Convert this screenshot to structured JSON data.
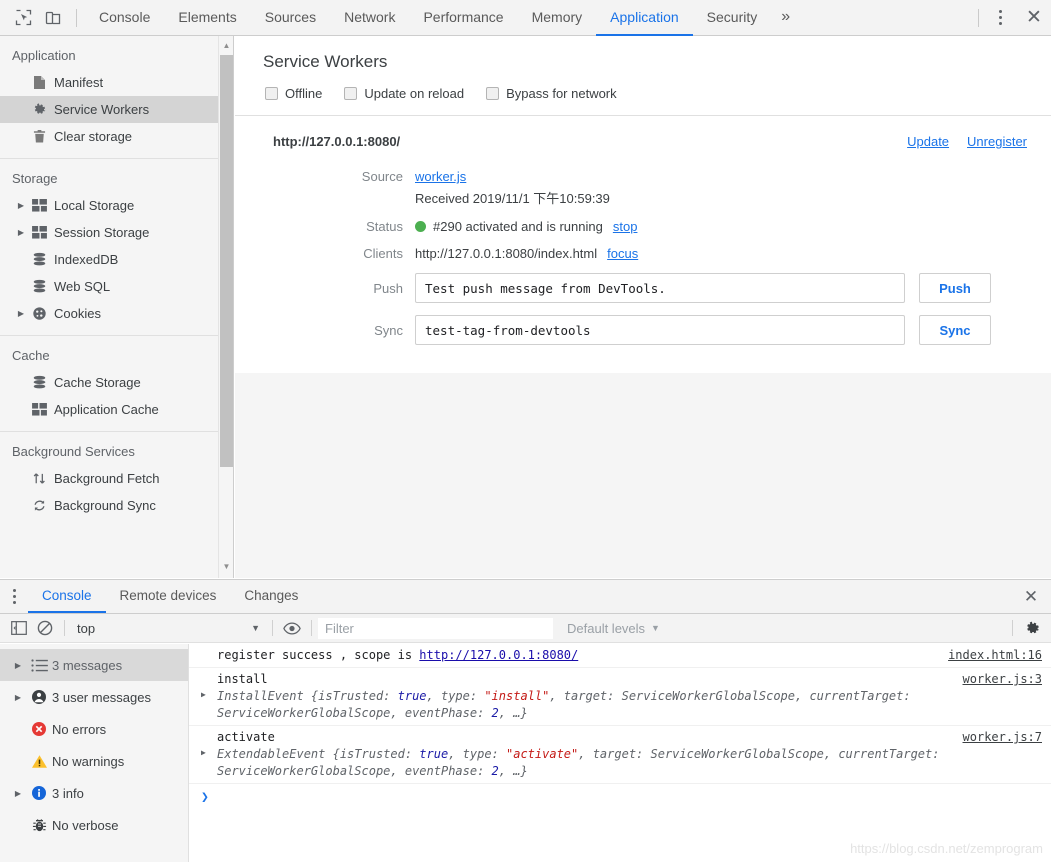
{
  "toolbar": {
    "inspect_icon": "inspect-cursor-icon",
    "device_icon": "device-toolbar-icon",
    "tabs": [
      {
        "label": "Console",
        "selected": false
      },
      {
        "label": "Elements",
        "selected": false
      },
      {
        "label": "Sources",
        "selected": false
      },
      {
        "label": "Network",
        "selected": false
      },
      {
        "label": "Performance",
        "selected": false
      },
      {
        "label": "Memory",
        "selected": false
      },
      {
        "label": "Application",
        "selected": true
      },
      {
        "label": "Security",
        "selected": false
      }
    ],
    "more_tabs_label": "»",
    "menu_label": "⋮",
    "close_label": "✕"
  },
  "sidebar": {
    "groups": [
      {
        "title": "Application",
        "items": [
          {
            "label": "Manifest",
            "icon": "document-icon",
            "arrow": false,
            "selected": false
          },
          {
            "label": "Service Workers",
            "icon": "gear-icon",
            "arrow": false,
            "selected": true
          },
          {
            "label": "Clear storage",
            "icon": "trash-icon",
            "arrow": false,
            "selected": false
          }
        ]
      },
      {
        "title": "Storage",
        "items": [
          {
            "label": "Local Storage",
            "icon": "table-icon",
            "arrow": true,
            "selected": false
          },
          {
            "label": "Session Storage",
            "icon": "table-icon",
            "arrow": true,
            "selected": false
          },
          {
            "label": "IndexedDB",
            "icon": "database-icon",
            "arrow": false,
            "selected": false
          },
          {
            "label": "Web SQL",
            "icon": "database-icon",
            "arrow": false,
            "selected": false
          },
          {
            "label": "Cookies",
            "icon": "cookie-icon",
            "arrow": true,
            "selected": false
          }
        ]
      },
      {
        "title": "Cache",
        "items": [
          {
            "label": "Cache Storage",
            "icon": "database-icon",
            "arrow": false,
            "selected": false
          },
          {
            "label": "Application Cache",
            "icon": "table-icon",
            "arrow": false,
            "selected": false
          }
        ]
      },
      {
        "title": "Background Services",
        "items": [
          {
            "label": "Background Fetch",
            "icon": "updown-arrows-icon",
            "arrow": false,
            "selected": false
          },
          {
            "label": "Background Sync",
            "icon": "refresh-icon",
            "arrow": false,
            "selected": false
          }
        ]
      }
    ]
  },
  "service_workers": {
    "title": "Service Workers",
    "options": [
      {
        "label": "Offline",
        "checked": false
      },
      {
        "label": "Update on reload",
        "checked": false
      },
      {
        "label": "Bypass for network",
        "checked": false
      }
    ],
    "origin": "http://127.0.0.1:8080/",
    "update_label": "Update",
    "unregister_label": "Unregister",
    "source_label": "Source",
    "source_value": "worker.js",
    "received_value": "Received 2019/11/1 下午10:59:39",
    "status_label": "Status",
    "status_value": "#290 activated and is running",
    "status_color": "#4caf50",
    "stop_label": "stop",
    "clients_label": "Clients",
    "clients_value": "http://127.0.0.1:8080/index.html",
    "focus_label": "focus",
    "push_label": "Push",
    "push_value": "Test push message from DevTools.",
    "push_button": "Push",
    "sync_label": "Sync",
    "sync_value": "test-tag-from-devtools",
    "sync_button": "Sync"
  },
  "drawer": {
    "tabs": [
      {
        "label": "Console",
        "selected": true
      },
      {
        "label": "Remote devices",
        "selected": false
      },
      {
        "label": "Changes",
        "selected": false
      }
    ],
    "close_label": "✕",
    "console_toolbar": {
      "sidebar_toggle_icon": "show-console-sidebar-icon",
      "clear_icon": "clear-console-icon",
      "context": "top",
      "eye_icon": "live-expression-icon",
      "filter_placeholder": "Filter",
      "filter_value": "",
      "levels": "Default levels",
      "settings_icon": "gear-icon"
    },
    "sidebar": [
      {
        "label": "3 messages",
        "icon": "list-icon",
        "arrow": true,
        "selected": true
      },
      {
        "label": "3 user messages",
        "icon": "user-icon",
        "arrow": true,
        "selected": false
      },
      {
        "label": "No errors",
        "icon": "error-icon",
        "arrow": false,
        "selected": false
      },
      {
        "label": "No warnings",
        "icon": "warning-icon",
        "arrow": false,
        "selected": false
      },
      {
        "label": "3 info",
        "icon": "info-icon",
        "arrow": true,
        "selected": false
      },
      {
        "label": "No verbose",
        "icon": "bug-icon",
        "arrow": false,
        "selected": false
      }
    ],
    "messages": [
      {
        "text": "register success , scope is ",
        "link": "http://127.0.0.1:8080/",
        "source": "index.html:16",
        "expandable": false,
        "detail": null
      },
      {
        "text": "install",
        "link": "",
        "source": "worker.js:3",
        "expandable": true,
        "detail_parts": [
          {
            "t": "InstallEvent {isTrusted: ",
            "c": "plain"
          },
          {
            "t": "true",
            "c": "bool"
          },
          {
            "t": ", type: ",
            "c": "plain"
          },
          {
            "t": "\"install\"",
            "c": "str"
          },
          {
            "t": ", target: ServiceWorkerGlobalScope, currentTarget: ServiceWorkerGlobalScope, eventPhase: ",
            "c": "plain"
          },
          {
            "t": "2",
            "c": "num"
          },
          {
            "t": ", …}",
            "c": "plain"
          }
        ]
      },
      {
        "text": "activate",
        "link": "",
        "source": "worker.js:7",
        "expandable": true,
        "detail_parts": [
          {
            "t": "ExtendableEvent {isTrusted: ",
            "c": "plain"
          },
          {
            "t": "true",
            "c": "bool"
          },
          {
            "t": ", type: ",
            "c": "plain"
          },
          {
            "t": "\"activate\"",
            "c": "str"
          },
          {
            "t": ", target: ServiceWorkerGlobalScope, currentTarget: ServiceWorkerGlobalScope, eventPhase: ",
            "c": "plain"
          },
          {
            "t": "2",
            "c": "num"
          },
          {
            "t": ", …}",
            "c": "plain"
          }
        ]
      }
    ],
    "prompt_symbol": "❯"
  },
  "watermark": "https://blog.csdn.net/zemprogram"
}
